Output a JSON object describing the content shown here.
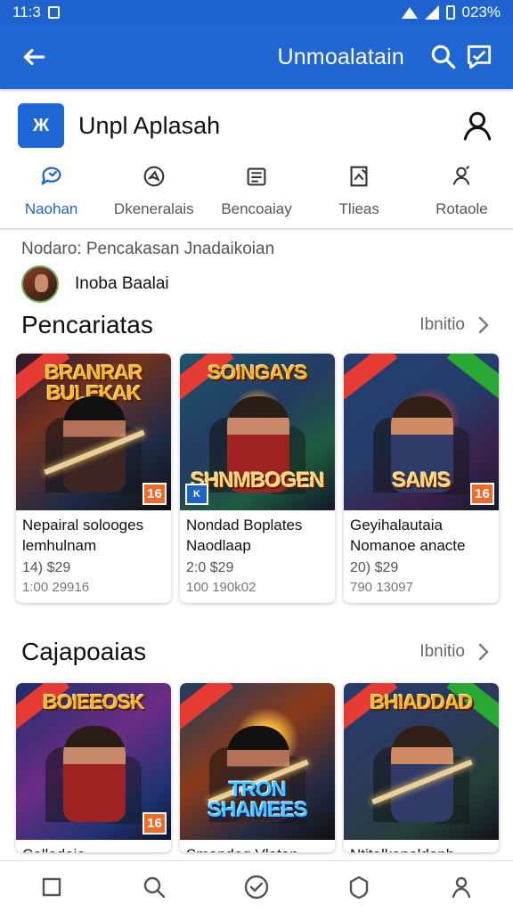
{
  "status": {
    "time": "11:3",
    "battery": "023%"
  },
  "app_bar": {
    "title": "Unmoalatain",
    "back_icon": "arrow-left-icon",
    "search_icon": "search-icon",
    "comment_icon": "comment-icon"
  },
  "header": {
    "logo_text": "Ж",
    "app_name": "Unpl Aplasah"
  },
  "tabs": [
    {
      "label": "Naohan",
      "icon": "chat-icon",
      "active": true
    },
    {
      "label": "Dkeneralais",
      "icon": "compass-icon",
      "active": false
    },
    {
      "label": "Bencoaiay",
      "icon": "list-icon",
      "active": false
    },
    {
      "label": "Tlieas",
      "icon": "image-icon",
      "active": false
    },
    {
      "label": "Rotaole",
      "icon": "people-icon",
      "active": false
    }
  ],
  "breadcrumb": "Nodaro: Pencakasan Jnadaikoian",
  "author": {
    "name": "Inobа Baalai"
  },
  "sections": [
    {
      "title": "Pencariatas",
      "link": "Ibnitio",
      "cards": [
        {
          "logo": "BRANRAR BULEKAK",
          "title1": "Nepairal solooges",
          "title2": "lemhulnam",
          "meta1": "14) $29",
          "meta2": "1:00 29916",
          "badge": "16"
        },
        {
          "logo": "SOINGAYS",
          "bottom_logo": "SHNMBOGEN",
          "title1": "Nondad Boplates",
          "title2": "Naodlaap",
          "meta1": "2:0 $29",
          "meta2": "100 190k02",
          "mini": "K"
        },
        {
          "logo": "SAMS",
          "title1": "Geyihalautaia",
          "title2": "Nomanoe anacte",
          "meta1": "20) $29",
          "meta2": "790 13097",
          "badge": "16"
        }
      ]
    },
    {
      "title": "Cajapoaias",
      "link": "Ibnitio",
      "cards": [
        {
          "logo": "BOIEEOSK",
          "title1": "Colladaio",
          "badge": "16"
        },
        {
          "logo": "TRON SHAMEES",
          "title1": "Smandeg Vlatan"
        },
        {
          "logo": "BHIADDAD",
          "title1": "Ntitalkanoldaph"
        }
      ]
    }
  ],
  "bottom_nav": [
    {
      "icon": "square-icon"
    },
    {
      "icon": "search-icon"
    },
    {
      "icon": "check-circle-icon"
    },
    {
      "icon": "shield-icon"
    },
    {
      "icon": "profile-icon"
    }
  ],
  "colors": {
    "primary": "#2067d4",
    "accent": "#1f63c8",
    "badge": "#f06a2a"
  }
}
